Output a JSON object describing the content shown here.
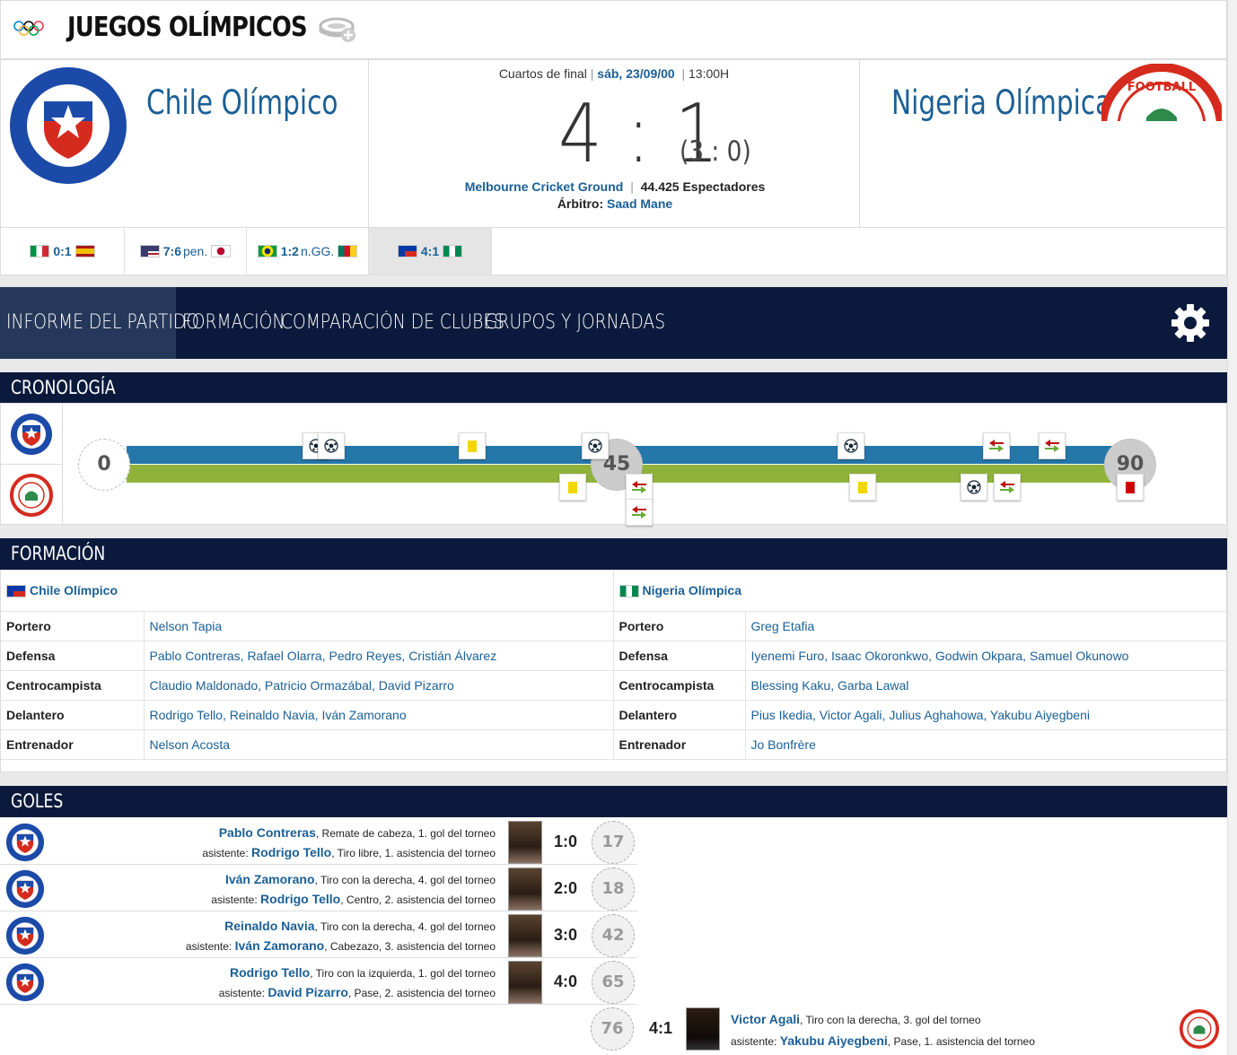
{
  "competition": {
    "title": "JUEGOS OLÍMPICOS"
  },
  "match": {
    "round": "Cuartos de final",
    "date": "sáb, 23/09/00",
    "time": "13:00H",
    "home": "Chile Olímpico",
    "away": "Nigeria Olímpica",
    "score": "4 : 1",
    "halftime": "(3 : 0)",
    "venue": "Melbourne Cricket Ground",
    "attendance": "44.425 Espectadores",
    "referee_label": "Árbitro:",
    "referee": "Saad Mane",
    "separator": "|"
  },
  "results": [
    {
      "score": "0:1",
      "suffix": "",
      "flag1": "italy",
      "flag2": "spain",
      "active": false
    },
    {
      "score": "7:6",
      "suffix": "pen.",
      "flag1": "usa",
      "flag2": "japan",
      "active": false
    },
    {
      "score": "1:2",
      "suffix": "n.GG.",
      "flag1": "brazil",
      "flag2": "cameroon",
      "active": false
    },
    {
      "score": "4:1",
      "suffix": "",
      "flag1": "chile",
      "flag2": "nigeria",
      "active": true
    }
  ],
  "nav": {
    "items": [
      "INFORME DEL PARTIDO",
      "FORMACIÓN",
      "COMPARACIÓN DE CLUBES",
      "GRUPOS Y JORNADAS"
    ],
    "active_index": 0
  },
  "timeline": {
    "title": "CRONOLOGÍA",
    "clock_start": "0",
    "clock_half": "45",
    "clock_end": "90",
    "home_events": [
      {
        "minute": 17,
        "type": "goal"
      },
      {
        "minute": 18,
        "type": "goal"
      },
      {
        "minute": 31,
        "type": "yellow"
      },
      {
        "minute": 42,
        "type": "goal"
      },
      {
        "minute": 65,
        "type": "goal"
      },
      {
        "minute": 78,
        "type": "sub"
      },
      {
        "minute": 83,
        "type": "sub"
      }
    ],
    "away_events": [
      {
        "minute": 40,
        "type": "yellow"
      },
      {
        "minute": 46,
        "type": "sub"
      },
      {
        "minute": 46,
        "type": "sub"
      },
      {
        "minute": 66,
        "type": "yellow"
      },
      {
        "minute": 76,
        "type": "goal"
      },
      {
        "minute": 79,
        "type": "sub"
      },
      {
        "minute": 90,
        "type": "red"
      }
    ]
  },
  "formation": {
    "title": "FORMACIÓN",
    "home_team": "Chile Olímpico",
    "away_team": "Nigeria Olímpica",
    "rows": [
      {
        "pos": "Portero",
        "home": "Nelson Tapia",
        "away": "Greg Etafia"
      },
      {
        "pos": "Defensa",
        "home": "Pablo Contreras, Rafael Olarra, Pedro Reyes, Cristián Álvarez",
        "away": "Iyenemi Furo, Isaac Okoronkwo, Godwin Okpara, Samuel Okunowo"
      },
      {
        "pos": "Centrocampista",
        "home": "Claudio Maldonado, Patricio Ormazábal, David Pizarro",
        "away": "Blessing Kaku, Garba Lawal"
      },
      {
        "pos": "Delantero",
        "home": "Rodrigo Tello, Reinaldo Navia, Iván Zamorano",
        "away": "Pius Ikedia, Victor Agali, Julius Aghahowa, Yakubu Aiyegbeni"
      },
      {
        "pos": "Entrenador",
        "home": "Nelson Acosta",
        "away": "Jo Bonfrère"
      }
    ]
  },
  "goals": {
    "title": "GOLES",
    "assist_label": "asistente:",
    "items": [
      {
        "scorer": "Pablo Contreras",
        "detail": ", Remate de cabeza, 1. gol del torneo",
        "assist": "Rodrigo Tello",
        "assist_detail": ", Tiro libre, 1. asistencia del torneo",
        "score": "1:0",
        "minute": "17",
        "side": "home"
      },
      {
        "scorer": "Iván Zamorano",
        "detail": ", Tiro con la derecha, 4. gol del torneo",
        "assist": "Rodrigo Tello",
        "assist_detail": ", Centro, 2. asistencia del torneo",
        "score": "2:0",
        "minute": "18",
        "side": "home"
      },
      {
        "scorer": "Reinaldo Navia",
        "detail": ", Tiro con la derecha, 4. gol del torneo",
        "assist": "Iván Zamorano",
        "assist_detail": ", Cabezazo, 3. asistencia del torneo",
        "score": "3:0",
        "minute": "42",
        "side": "home"
      },
      {
        "scorer": "Rodrigo Tello",
        "detail": ", Tiro con la izquierda, 1. gol del torneo",
        "assist": "David Pizarro",
        "assist_detail": ", Pase, 2. asistencia del torneo",
        "score": "4:0",
        "minute": "65",
        "side": "home"
      },
      {
        "scorer": "Victor Agali",
        "detail": ", Tiro con la derecha, 3. gol del torneo",
        "assist": "Yakubu Aiyegbeni",
        "assist_detail": ", Pase, 1. asistencia del torneo",
        "score": "4:1",
        "minute": "76",
        "side": "away"
      }
    ]
  },
  "colors": {
    "navy": "#0b1a3c",
    "link": "#1a5f96",
    "home_bar": "#2677a9",
    "away_bar": "#8fb23a"
  },
  "icons": [
    "olympic-rings-icon",
    "stadium-add-icon",
    "gear-icon",
    "ball-icon",
    "yellow-card-icon",
    "red-card-icon",
    "substitution-icon"
  ]
}
